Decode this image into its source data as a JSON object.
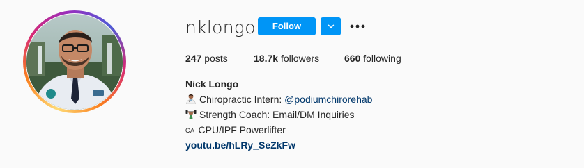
{
  "profile": {
    "username": "nklongo",
    "follow_label": "Follow",
    "dropdown_icon": "chevron-down-icon",
    "more_icon": "more-options-icon",
    "avatar_alt": "profile photo"
  },
  "stats": {
    "posts_count": "247",
    "posts_label": "posts",
    "followers_count": "18.7k",
    "followers_label": "followers",
    "following_count": "660",
    "following_label": "following"
  },
  "bio": {
    "name": "Nick Longo",
    "line1_text": "Chiropractic Intern: ",
    "line1_mention": "@podiumchirorehab",
    "line1_icon": "health-worker-emoji-icon",
    "line2_text": "Strength Coach: Email/DM Inquiries",
    "line2_icon": "weightlifter-emoji-icon",
    "line3_flag": "CA",
    "line3_text": "CPU/IPF Powerlifter",
    "link": "youtu.be/hLRy_SeZkFw"
  },
  "colors": {
    "accent": "#0095f6",
    "link": "#00376b",
    "text": "#262626",
    "background": "#fafafa"
  }
}
